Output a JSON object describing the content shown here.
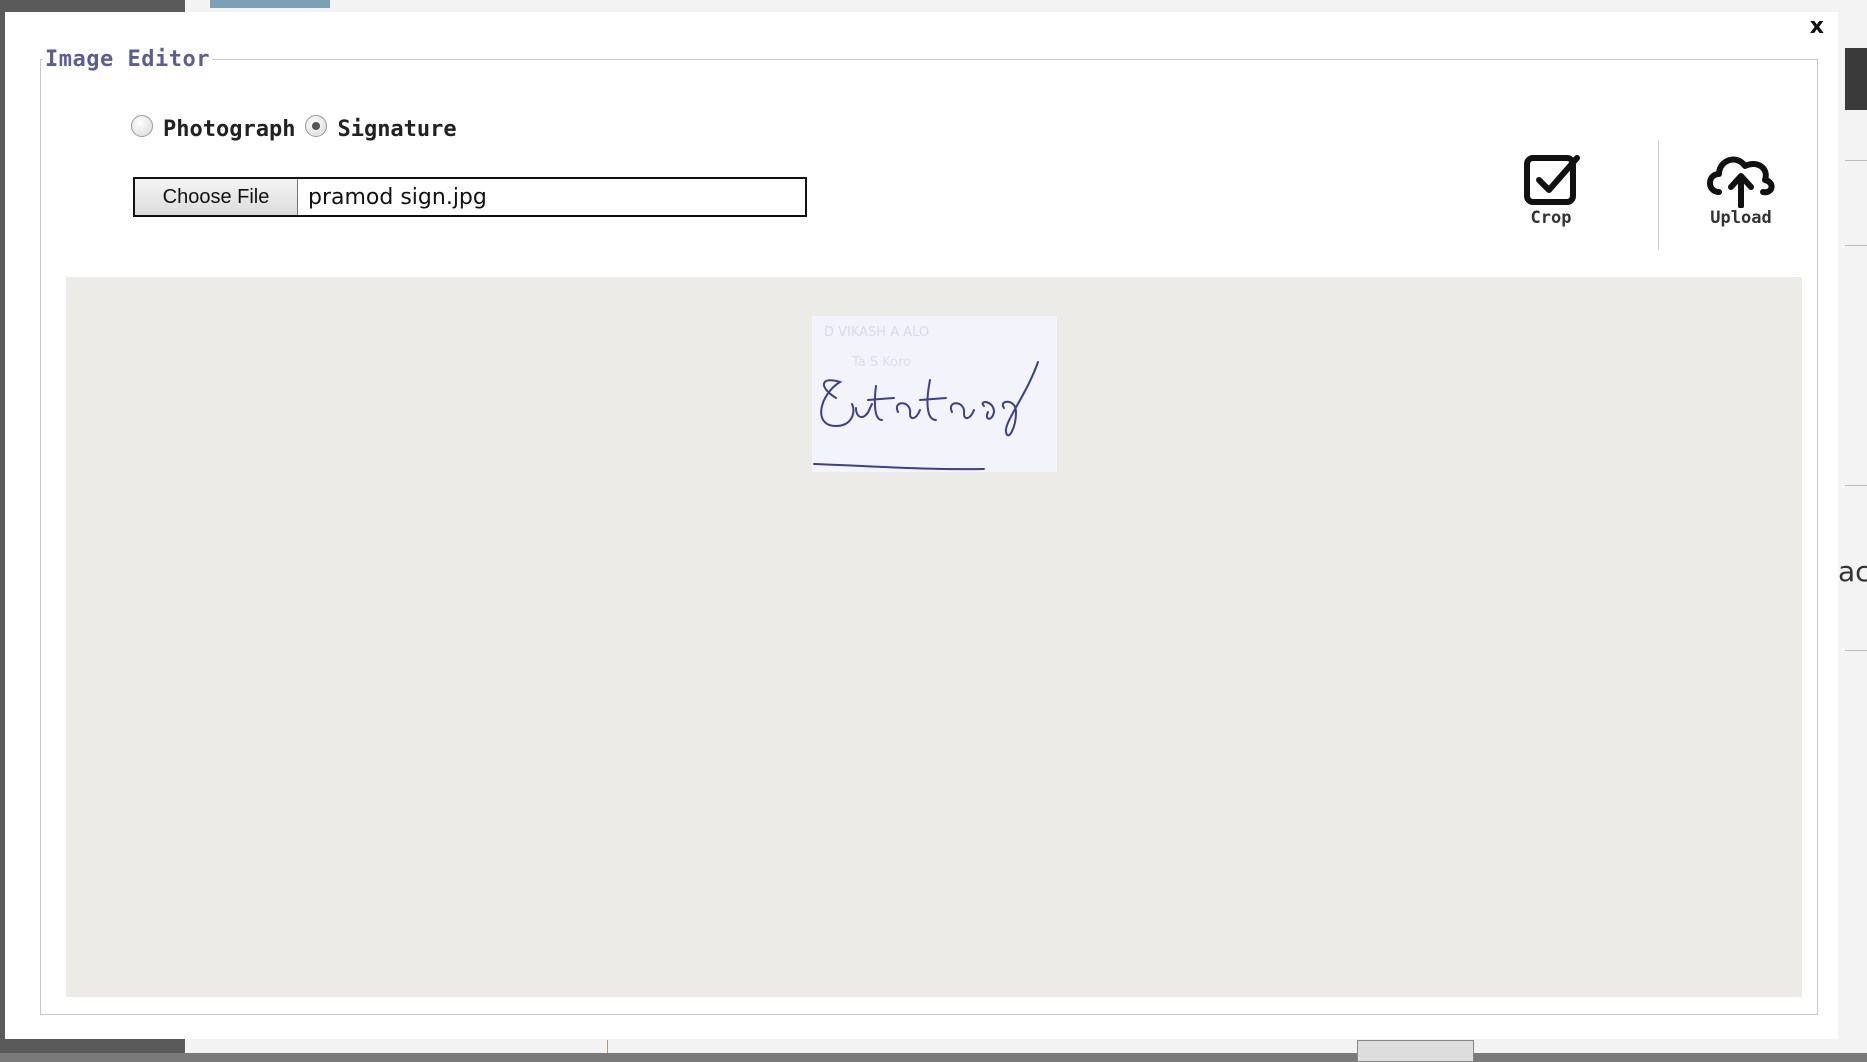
{
  "modal": {
    "close_label": "x",
    "title": "Image Editor",
    "radio_options": [
      {
        "label": "Photograph",
        "selected": false
      },
      {
        "label": "Signature",
        "selected": true
      }
    ],
    "file_input": {
      "button_label": "Choose File",
      "file_name": "pramod sign.jpg"
    },
    "tools": {
      "crop_label": "Crop",
      "upload_label": "Upload"
    },
    "preview": {
      "signature_text": "Sutatay"
    }
  },
  "background": {
    "partial_text": "ac"
  },
  "colors": {
    "legend": "#5a5e96",
    "canvas": "#ecebe7",
    "ink": "#3b3f8c"
  }
}
